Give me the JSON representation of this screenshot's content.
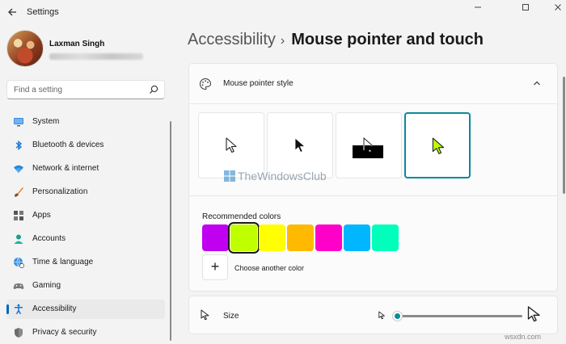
{
  "window": {
    "title": "Settings",
    "back_icon": "arrow-left-icon",
    "minimize_icon": "minimize-icon",
    "maximize_icon": "maximize-icon",
    "close_icon": "close-icon"
  },
  "user": {
    "name": "Laxman Singh",
    "email_redacted": true
  },
  "search": {
    "placeholder": "Find a setting"
  },
  "sidebar": {
    "items": [
      {
        "label": "System",
        "icon": "monitor-icon"
      },
      {
        "label": "Bluetooth & devices",
        "icon": "bluetooth-icon"
      },
      {
        "label": "Network & internet",
        "icon": "wifi-icon"
      },
      {
        "label": "Personalization",
        "icon": "paintbrush-icon"
      },
      {
        "label": "Apps",
        "icon": "apps-grid-icon"
      },
      {
        "label": "Accounts",
        "icon": "person-icon"
      },
      {
        "label": "Time & language",
        "icon": "globe-clock-icon"
      },
      {
        "label": "Gaming",
        "icon": "gamepad-icon"
      },
      {
        "label": "Accessibility",
        "icon": "accessibility-icon",
        "active": true
      },
      {
        "label": "Privacy & security",
        "icon": "shield-icon"
      }
    ]
  },
  "breadcrumb": {
    "parent": "Accessibility",
    "separator": "›",
    "current": "Mouse pointer and touch"
  },
  "pointer_style": {
    "header": "Mouse pointer style",
    "options": [
      "white",
      "black",
      "inverted",
      "custom"
    ],
    "selected": "custom",
    "recommended_label": "Recommended colors",
    "colors": [
      "#c000f0",
      "#bfff00",
      "#ffff00",
      "#ffb900",
      "#ff00c8",
      "#00b7ff",
      "#00ffba"
    ],
    "selected_color": "#bfff00",
    "choose_another": "Choose another color",
    "add_symbol": "+"
  },
  "size": {
    "label": "Size",
    "value_fraction": 0.0
  },
  "watermark": "TheWindowsClub",
  "footer_watermark": "wsxdn.com",
  "colors": {
    "accent": "#0a8a9a",
    "nav_indicator": "#0067c0"
  }
}
